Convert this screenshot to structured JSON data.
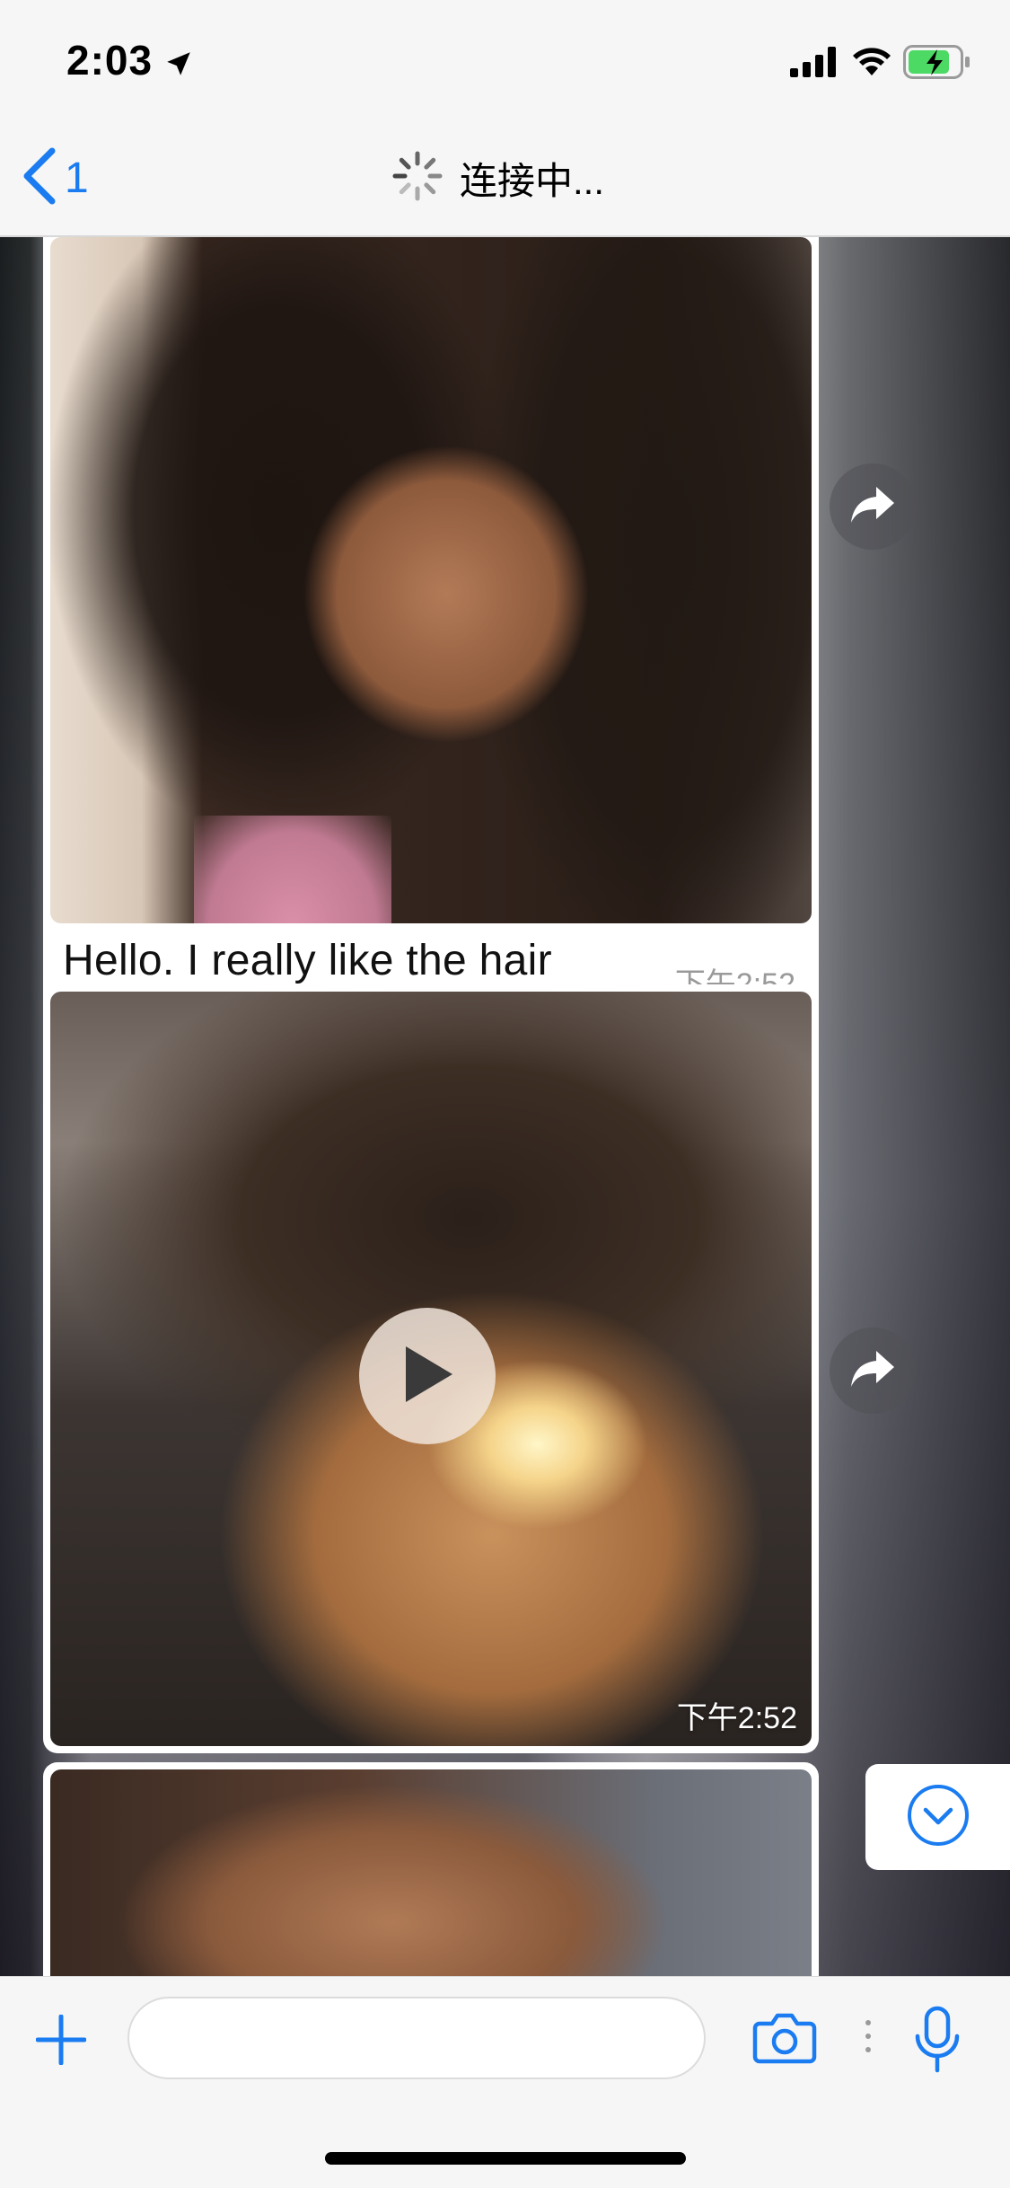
{
  "status_bar": {
    "time": "2:03",
    "location_icon": "location-arrow-icon",
    "signal_icon": "cellular-signal-icon",
    "wifi_icon": "wifi-icon",
    "battery_icon": "battery-charging-icon",
    "battery_color": "#4cd964"
  },
  "nav": {
    "back_icon": "chevron-left-icon",
    "back_count": "1",
    "loading_icon": "spinner-icon",
    "title": "连接中..."
  },
  "messages": [
    {
      "type": "image",
      "caption": "Hello. I really like the hair",
      "time": "下午2:52"
    },
    {
      "type": "video",
      "time": "下午2:52",
      "play_icon": "play-icon"
    },
    {
      "type": "image"
    }
  ],
  "actions": {
    "forward_icon": "forward-icon",
    "scroll_down_icon": "chevron-down-circle-icon"
  },
  "input_bar": {
    "add_icon": "plus-icon",
    "message_value": "",
    "message_placeholder": "",
    "camera_icon": "camera-icon",
    "more_icon": "vertical-dots-icon",
    "mic_icon": "microphone-icon"
  },
  "colors": {
    "accent": "#1a7cf0",
    "bubble": "#ffffff",
    "timestamp": "#9a9a9a"
  }
}
